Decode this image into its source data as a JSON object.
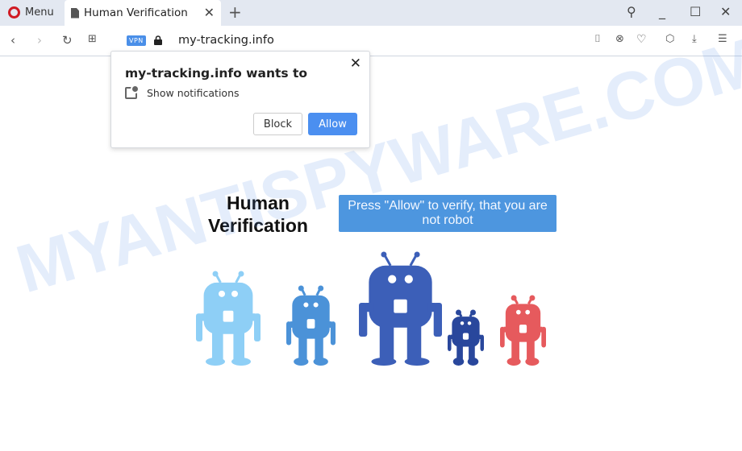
{
  "browser": {
    "menu_label": "Menu",
    "tab_title": "Human Verification",
    "url": "my-tracking.info",
    "vpn_label": "VPN"
  },
  "popup": {
    "title": "my-tracking.info wants to",
    "permission": "Show notifications",
    "block_label": "Block",
    "allow_label": "Allow"
  },
  "page": {
    "title_line1": "Human",
    "title_line2": "Verification",
    "banner": "Press \"Allow\" to verify, that you are not robot"
  },
  "watermark": "MYANTISPYWARE.COM",
  "robot_colors": [
    "#8ecff6",
    "#4b92d8",
    "#3c5fb8",
    "#29479c",
    "#e65a5d"
  ]
}
